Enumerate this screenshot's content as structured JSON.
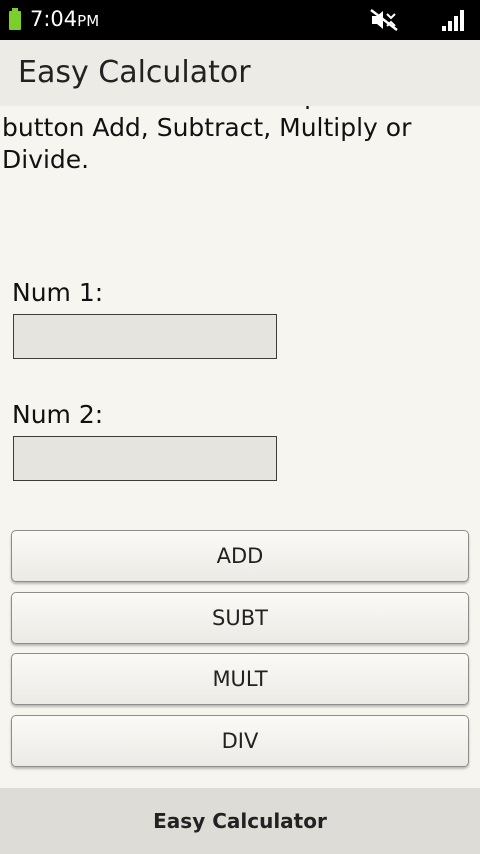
{
  "status_bar": {
    "time": "7:04",
    "ampm": "PM",
    "icons": [
      "battery-icon",
      "silent-mode-icon",
      "signal-icon"
    ],
    "battery_color": "#7ccf2a"
  },
  "action_bar": {
    "title": "Easy Calculator"
  },
  "instructions": "Enter two numbers and press the button Add, Subtract, Multiply or Divide.",
  "form": {
    "num1_label": "Num 1:",
    "num1_value": "",
    "num2_label": "Num 2:",
    "num2_value": ""
  },
  "buttons": {
    "add": "ADD",
    "subtract": "SUBT",
    "multiply": "MULT",
    "divide": "DIV"
  },
  "bottom_bar": {
    "label": "Easy Calculator"
  }
}
